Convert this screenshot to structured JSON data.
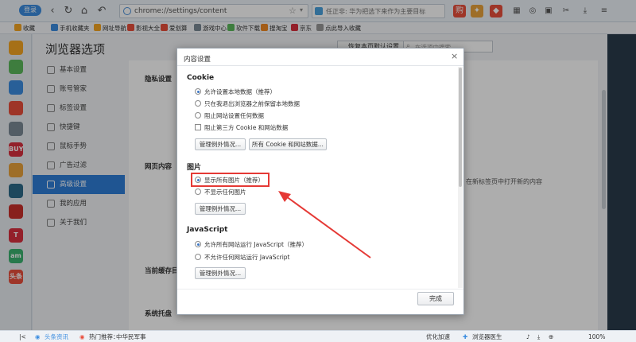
{
  "toolbar": {
    "login_label": "登录",
    "address": "chrome://settings/content",
    "search_text": "任正非: 华为把选下来作为主要目标",
    "icons": [
      "back-icon",
      "refresh-icon",
      "home-icon",
      "undo-icon",
      "star-icon",
      "gift-icon",
      "menu-icon"
    ]
  },
  "bookmarks": {
    "items": [
      {
        "label": "收藏",
        "color": "#f5a623"
      },
      {
        "label": "手机收藏夹",
        "color": "#3b8de0"
      },
      {
        "label": "网址导航",
        "color": "#f5a623"
      },
      {
        "label": "影视大全",
        "color": "#e94e3c"
      },
      {
        "label": "爱划算",
        "color": "#e94e3c"
      },
      {
        "label": "游戏中心",
        "color": "#7b8a96"
      },
      {
        "label": "软件下载",
        "color": "#5cb85c"
      },
      {
        "label": "搜淘宝",
        "color": "#f08a24"
      },
      {
        "label": "京东",
        "color": "#d9303f"
      },
      {
        "label": "点此导入收藏",
        "color": "#999999"
      }
    ]
  },
  "settings": {
    "page_title": "浏览器选项",
    "restore_label": "恢复本页默认设置",
    "search_placeholder": "在选项中搜索",
    "menu": [
      {
        "label": "基本设置",
        "active": false
      },
      {
        "label": "账号管家",
        "active": false
      },
      {
        "label": "标签设置",
        "active": false
      },
      {
        "label": "快捷键",
        "active": false
      },
      {
        "label": "鼠标手势",
        "active": false
      },
      {
        "label": "广告过滤",
        "active": false
      },
      {
        "label": "高级设置",
        "active": true
      },
      {
        "label": "我的应用",
        "active": false
      },
      {
        "label": "关于我们",
        "active": false
      }
    ],
    "sections": {
      "privacy": "隐私设置",
      "webcontent": "网页内容",
      "cache": "当前缓存目",
      "tray": "系统托盘"
    },
    "background_text": "在新标签页中打开新的内容"
  },
  "dialog": {
    "title": "内容设置",
    "close": "×",
    "cookie": {
      "title": "Cookie",
      "options": [
        {
          "label": "允许设置本地数据（推荐）",
          "type": "radio",
          "selected": true
        },
        {
          "label": "只在我退出浏览器之前保留本地数据",
          "type": "radio",
          "selected": false
        },
        {
          "label": "阻止网站设置任何数据",
          "type": "radio",
          "selected": false
        },
        {
          "label": "阻止第三方 Cookie 和网站数据",
          "type": "checkbox",
          "selected": false
        }
      ],
      "button_exceptions": "管理例外情况...",
      "button_all": "所有 Cookie 和网站数据..."
    },
    "images": {
      "title": "图片",
      "options": [
        {
          "label": "显示所有图片（推荐）",
          "type": "radio",
          "selected": true
        },
        {
          "label": "不显示任何图片",
          "type": "radio",
          "selected": false
        }
      ],
      "button_exceptions": "管理例外情况..."
    },
    "javascript": {
      "title": "JavaScript",
      "options": [
        {
          "label": "允许所有网站运行 JavaScript（推荐）",
          "type": "radio",
          "selected": true
        },
        {
          "label": "不允许任何网站运行 JavaScript",
          "type": "radio",
          "selected": false
        }
      ],
      "button_exceptions": "管理例外情况..."
    },
    "done_label": "完成"
  },
  "apps": [
    {
      "label": "",
      "color": "#f5a623"
    },
    {
      "label": "",
      "color": "#5cb85c"
    },
    {
      "label": "",
      "color": "#3b8de0"
    },
    {
      "label": "",
      "color": "#e94e3c"
    },
    {
      "label": "",
      "color": "#7b8a96"
    },
    {
      "label": "BUY",
      "color": "#d9303f"
    },
    {
      "label": "",
      "color": "#e9a23b"
    },
    {
      "label": "",
      "color": "#2d6a8a"
    },
    {
      "label": "",
      "color": "#c9302c"
    },
    {
      "label": "T",
      "color": "#d9303f"
    },
    {
      "label": "am",
      "color": "#3cb371"
    },
    {
      "label": "头条",
      "color": "#e94e3c"
    }
  ],
  "statusbar": {
    "news": "头条资讯",
    "hot": "热门推荐：",
    "hot_item": "中华民军事",
    "speed": "优化加速",
    "doctor": "浏览器医生",
    "zoom": "100%"
  },
  "colors": {
    "accent": "#2f7ed8",
    "annotation": "#e53935"
  }
}
